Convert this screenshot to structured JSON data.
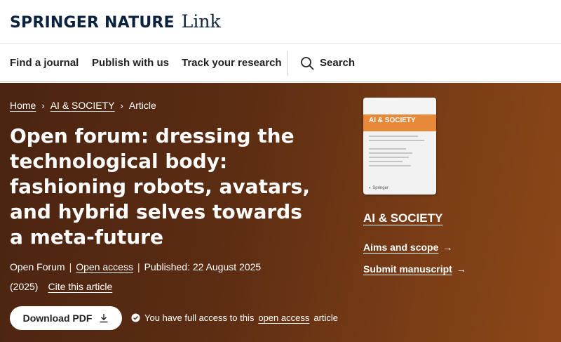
{
  "header": {
    "brand": "SPRINGER NATURE",
    "product": "Link"
  },
  "nav": {
    "items": [
      "Find a journal",
      "Publish with us",
      "Track your research"
    ],
    "search_label": "Search"
  },
  "breadcrumb": {
    "items": [
      "Home",
      "AI & SOCIETY",
      "Article"
    ],
    "separator": "›"
  },
  "article": {
    "title": "Open forum: dressing the technological body: fashioning robots, avatars, and hybrid selves towards a meta-future",
    "type": "Open Forum",
    "access_label": "Open access",
    "published": "Published: 22 August 2025",
    "year": "(2025)",
    "cite_label": "Cite this article",
    "download_label": "Download PDF",
    "access_note_prefix": "You have full access to this",
    "access_note_link": "open access",
    "access_note_suffix": "article"
  },
  "journal": {
    "cover_title": "AI & SOCIETY",
    "name": "AI & SOCIETY",
    "links": [
      "Aims and scope",
      "Submit manuscript"
    ]
  },
  "colors": {
    "hero_start": "#4a2411",
    "hero_end": "#8c4718",
    "brand_navy": "#0c2340",
    "cover_band": "#e8893a"
  }
}
